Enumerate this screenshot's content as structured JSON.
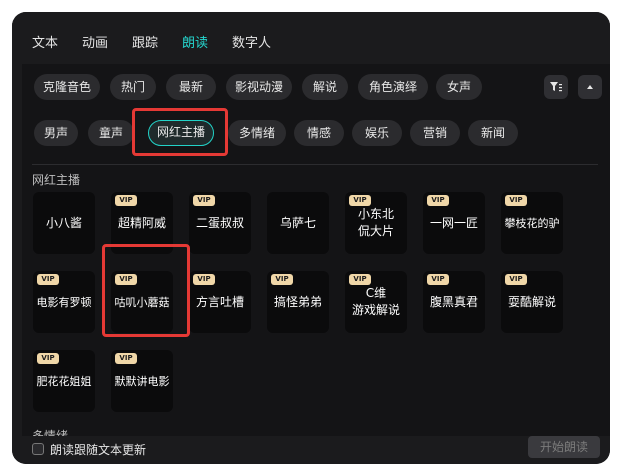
{
  "tabs": [
    "文本",
    "动画",
    "跟踪",
    "朗读",
    "数字人"
  ],
  "active_tab": "朗读",
  "filter_row1": [
    "克隆音色",
    "热门",
    "最新",
    "影视动漫",
    "解说",
    "角色演绎",
    "女声"
  ],
  "filter_row2": [
    "男声",
    "童声",
    "网红主播",
    "多情绪",
    "情感",
    "娱乐",
    "营销",
    "新闻"
  ],
  "selected_filter": "网红主播",
  "section_title": "网红主播",
  "vip_badge": "VIP",
  "voices": [
    {
      "name": "小八酱",
      "vip": false
    },
    {
      "name": "超精阿威",
      "vip": true
    },
    {
      "name": "二蛋叔叔",
      "vip": true
    },
    {
      "name": "乌萨七",
      "vip": false
    },
    {
      "name": "小东北\n侃大片",
      "vip": true
    },
    {
      "name": "一网一匠",
      "vip": true
    },
    {
      "name": "攀枝花的驴",
      "vip": true
    },
    {
      "name": "电影有罗顿",
      "vip": true
    },
    {
      "name": "咕叽小蘑菇",
      "vip": true
    },
    {
      "name": "方言吐槽",
      "vip": true
    },
    {
      "name": "搞怪弟弟",
      "vip": true
    },
    {
      "name": "C维\n游戏解说",
      "vip": true
    },
    {
      "name": "腹黑真君",
      "vip": true
    },
    {
      "name": "耍酷解说",
      "vip": true
    },
    {
      "name": "肥花花姐姐",
      "vip": true
    },
    {
      "name": "默默讲电影",
      "vip": true
    }
  ],
  "next_section_title": "多情绪",
  "footer": {
    "checkbox_label": "朗读跟随文本更新",
    "start_button": "开始朗读"
  }
}
